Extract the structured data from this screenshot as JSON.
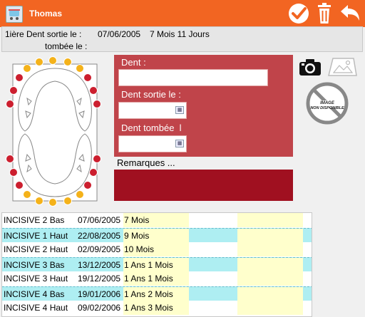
{
  "colors": {
    "title_bar": "#f26522",
    "form_panel": "#c0444a",
    "remarks_box": "#a01020",
    "row_highlight": "#aeeef2",
    "cell_yellow": "#ffffcc",
    "tooth_erupted": "#cc1f2f",
    "tooth_pending": "#f4b21a"
  },
  "window": {
    "title": "Thomas",
    "app_icon": "baby-icon",
    "buttons": [
      {
        "name": "validate-button",
        "icon": "check-circle-icon"
      },
      {
        "name": "delete-button",
        "icon": "trash-icon"
      },
      {
        "name": "back-button",
        "icon": "undo-arrow-icon"
      }
    ]
  },
  "info": {
    "first_tooth_label": "1ière Dent sortie le :",
    "first_tooth_date": "07/06/2005",
    "first_tooth_age": "7 Mois 11 Jours",
    "fallen_label": "tombée le :",
    "fallen_value": ""
  },
  "form": {
    "tooth_label": "Dent :",
    "tooth_value": "",
    "out_label": "Dent sortie le :",
    "out_value": "",
    "fallen_label": "Dent tombée  l",
    "fallen_value": "",
    "remarks_label": "Remarques ..."
  },
  "media": {
    "camera_icon": "camera-icon",
    "gallery_icon": "image-frame-icon",
    "no_image_text_1": "IMAGE",
    "no_image_text_2": "NON DISPONIBLE"
  },
  "tooth_chart": {
    "upper": [
      "pending",
      "pending",
      "pending",
      "pending",
      "pending",
      "erupted",
      "erupted",
      "erupted",
      "erupted",
      "erupted",
      "erupted"
    ],
    "lower": [
      "pending",
      "pending",
      "pending",
      "pending",
      "pending",
      "erupted",
      "erupted",
      "erupted",
      "erupted",
      "erupted",
      "erupted"
    ]
  },
  "table": {
    "rows": [
      {
        "tooth": "INCISIVE 2 Bas",
        "date": "07/06/2005",
        "age": "7 Mois",
        "highlight": false
      },
      {
        "tooth": "INCISIVE 1 Haut",
        "date": "22/08/2005",
        "age": "9 Mois",
        "highlight": true
      },
      {
        "tooth": "INCISIVE 2 Haut",
        "date": "02/09/2005",
        "age": "10 Mois",
        "highlight": false
      },
      {
        "tooth": "INCISIVE 3 Bas",
        "date": "13/12/2005",
        "age": "1 Ans 1 Mois",
        "highlight": true
      },
      {
        "tooth": "INCISIVE 3 Haut",
        "date": "19/12/2005",
        "age": "1 Ans 1 Mois",
        "highlight": false
      },
      {
        "tooth": "INCISIVE 4 Bas",
        "date": "19/01/2006",
        "age": "1 Ans 2 Mois",
        "highlight": true
      },
      {
        "tooth": "INCISIVE 4 Haut",
        "date": "09/02/2006",
        "age": "1 Ans 3 Mois",
        "highlight": false
      }
    ]
  }
}
